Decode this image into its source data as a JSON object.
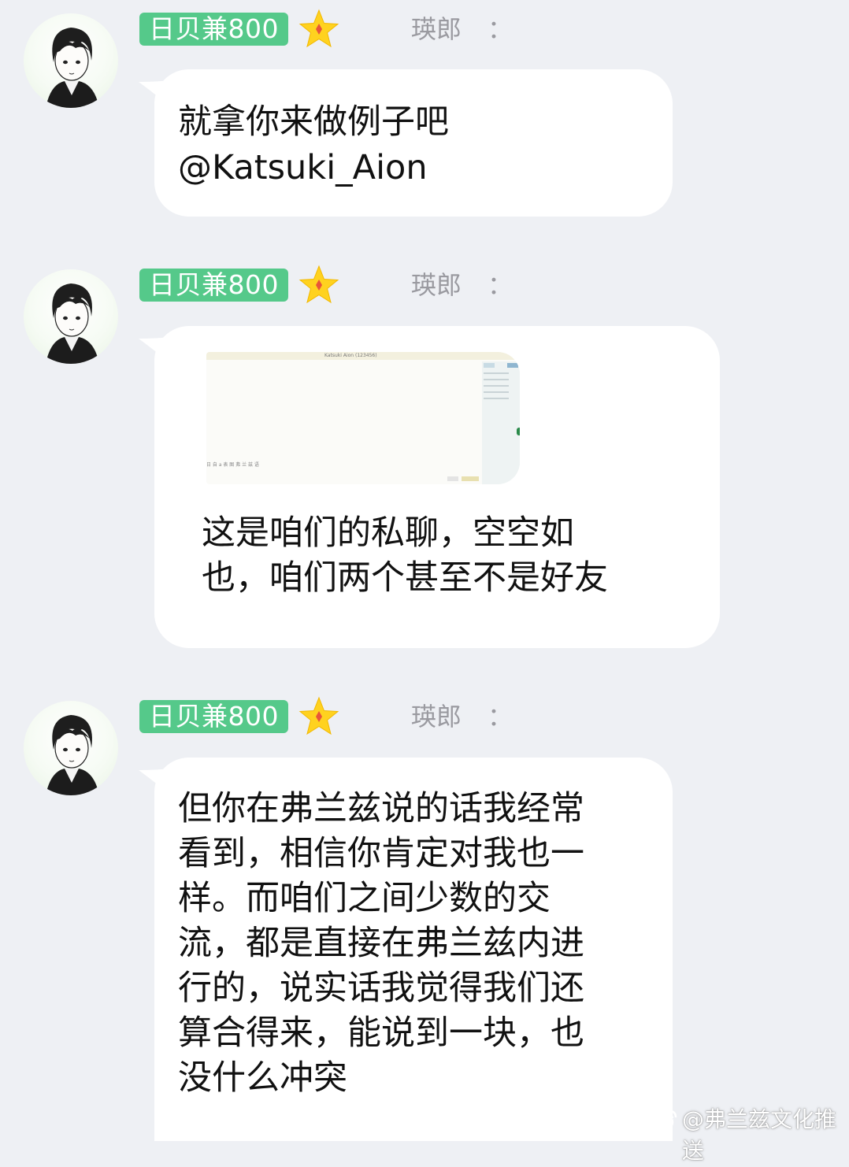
{
  "messages": [
    {
      "badge": "日贝兼800",
      "sender": "瑛郎",
      "colon": "：",
      "lines": [
        "就拿你来做例子吧",
        "@Katsuki_Aion"
      ]
    },
    {
      "badge": "日贝兼800",
      "sender": "瑛郎",
      "colon": "：",
      "image": {
        "title_text": "Katsuki Aion (123456)",
        "bottom_text": "日 自 a 表 图 弗 兰 兹 语"
      },
      "lines": [
        "这是咱们的私聊，空空如",
        "也，咱们两个甚至不是好友"
      ]
    },
    {
      "badge": "日贝兼800",
      "sender": "瑛郎",
      "colon": "：",
      "lines": [
        "但你在弗兰兹说的话我经常",
        "看到，相信你肯定对我也一",
        "样。而咱们之间少数的交",
        "流，都是直接在弗兰兹内进",
        "行的，说实话我觉得我们还",
        "算合得来，能说到一块，也",
        "没什么冲突"
      ]
    }
  ],
  "watermark": {
    "icon": "weibo-icon",
    "text": "@弗兰兹文化推送"
  },
  "colors": {
    "background": "#eef0f4",
    "bubble": "#ffffff",
    "badge": "#55c98a",
    "star": "#ffd21f",
    "sender": "#9a9aa0"
  }
}
